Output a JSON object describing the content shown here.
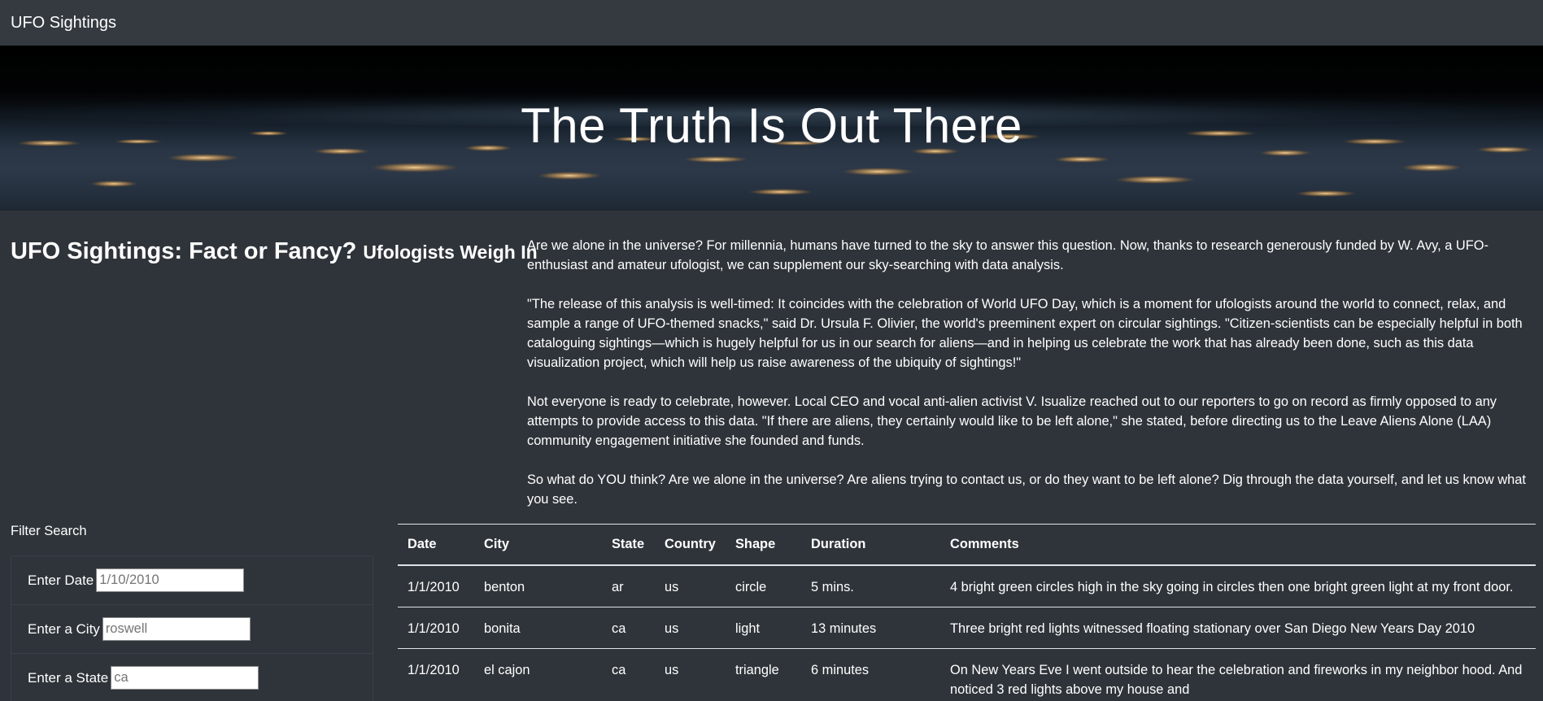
{
  "navbar": {
    "brand": "UFO Sightings"
  },
  "hero": {
    "title": "The Truth Is Out There"
  },
  "headline": {
    "main": "UFO Sightings: Fact or Fancy?",
    "sub": "Ufologists Weigh In"
  },
  "article": {
    "paragraphs": [
      "Are we alone in the universe? For millennia, humans have turned to the sky to answer this question. Now, thanks to research generously funded by W. Avy, a UFO-enthusiast and amateur ufologist, we can supplement our sky-searching with data analysis.",
      "\"The release of this analysis is well-timed: It coincides with the celebration of World UFO Day, which is a moment for ufologists around the world to connect, relax, and sample a range of UFO-themed snacks,\" said Dr. Ursula F. Olivier, the world's preeminent expert on circular sightings. \"Citizen-scientists can be especially helpful in both cataloguing sightings—which is hugely helpful for us in our search for aliens—and in helping us celebrate the work that has already been done, such as this data visualization project, which will help us raise awareness of the ubiquity of sightings!\"",
      "Not everyone is ready to celebrate, however. Local CEO and vocal anti-alien activist V. Isualize reached out to our reporters to go on record as firmly opposed to any attempts to provide access to this data. \"If there are aliens, they certainly would like to be left alone,\" she stated, before directing us to the Leave Aliens Alone (LAA) community engagement initiative she founded and funds.",
      "So what do YOU think? Are we alone in the universe? Are aliens trying to contact us, or do they want to be left alone? Dig through the data yourself, and let us know what you see."
    ]
  },
  "filter": {
    "title": "Filter Search",
    "fields": [
      {
        "label": "Enter Date",
        "placeholder": "1/10/2010"
      },
      {
        "label": "Enter a City",
        "placeholder": "roswell"
      },
      {
        "label": "Enter a State",
        "placeholder": "ca"
      }
    ]
  },
  "table": {
    "headers": [
      "Date",
      "City",
      "State",
      "Country",
      "Shape",
      "Duration",
      "Comments"
    ],
    "rows": [
      [
        "1/1/2010",
        "benton",
        "ar",
        "us",
        "circle",
        "5 mins.",
        "4 bright green circles high in the sky going in circles then one bright green light at my front door."
      ],
      [
        "1/1/2010",
        "bonita",
        "ca",
        "us",
        "light",
        "13 minutes",
        "Three bright red lights witnessed floating stationary over San Diego New Years Day 2010"
      ],
      [
        "1/1/2010",
        "el cajon",
        "ca",
        "us",
        "triangle",
        "6 minutes",
        "On New Years Eve I went outside to hear the celebration and fireworks in my neighbor hood. And noticed 3 red lights above my house and"
      ]
    ]
  },
  "colors": {
    "background": "#2f343a",
    "navbar": "#343a40",
    "text": "#ffffff",
    "table_border": "#dee2e6"
  }
}
